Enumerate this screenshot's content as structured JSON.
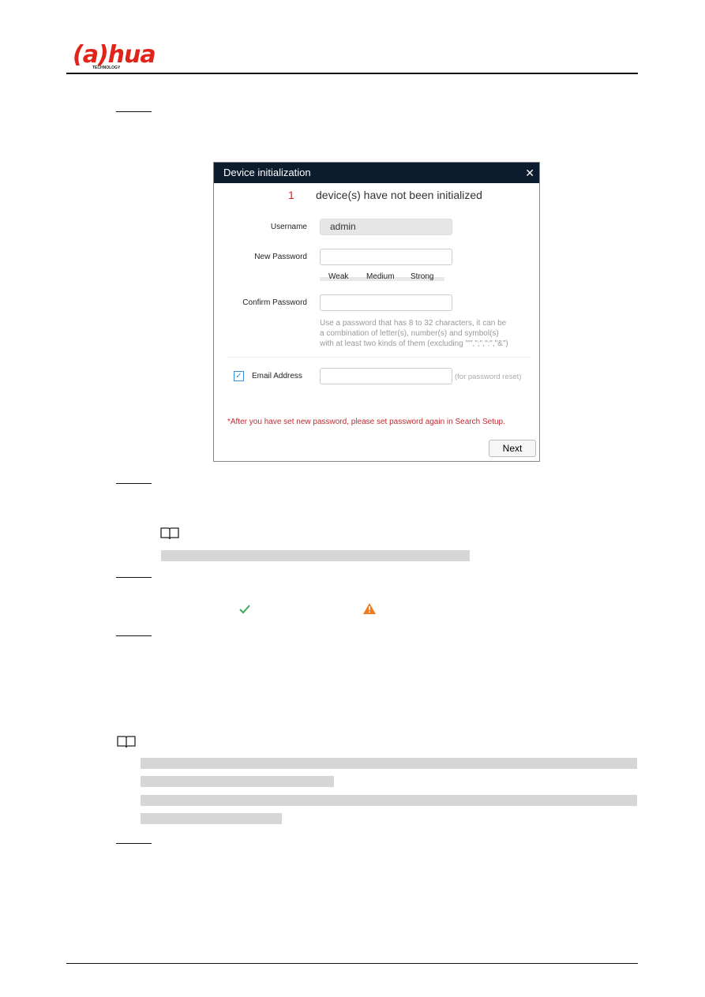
{
  "header": {
    "logo_text": "alhua",
    "logo_subtext": "TECHNOLOGY"
  },
  "dialog": {
    "title": "Device initialization",
    "close_icon": "close-icon",
    "count": "1",
    "status_text": "device(s) have not been initialized",
    "username_label": "Username",
    "username_value": "admin",
    "new_password_label": "New Password",
    "new_password_value": "",
    "strength": [
      "Weak",
      "Medium",
      "Strong"
    ],
    "confirm_password_label": "Confirm Password",
    "confirm_password_value": "",
    "password_hint": [
      "Use a password that has 8 to 32 characters, it can be",
      "a combination of letter(s), number(s) and symbol(s)",
      "with at least two kinds of them  (excluding \"'\",\";\",\":\",\"&\")"
    ],
    "email_checked": true,
    "email_label": "Email Address",
    "email_value": "",
    "email_hint": "(for password reset)",
    "warning": "*After you have set new password, please set password again in Search Setup.",
    "next_label": "Next",
    "colors": {
      "title_bar": "#0d1b2e",
      "count": "#e2231a",
      "warning": "#c0292f",
      "checkbox": "#3a8fd8"
    }
  },
  "icons": {
    "note": "book-icon",
    "success": "check-icon",
    "warning": "warning-icon"
  }
}
